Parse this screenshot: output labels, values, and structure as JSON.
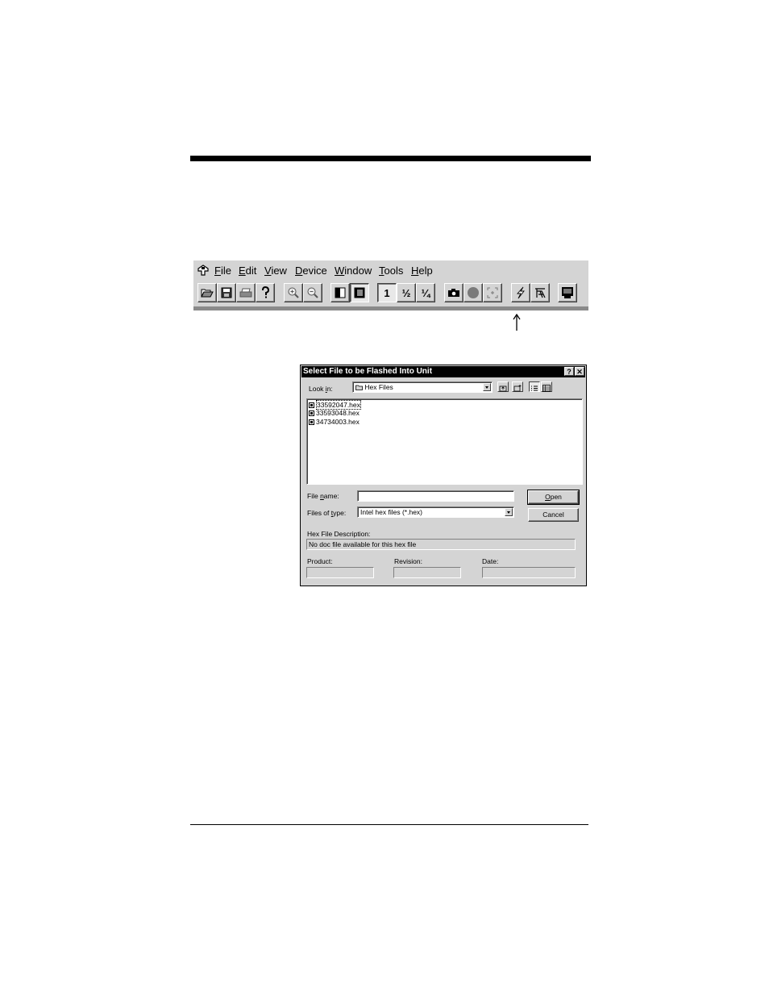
{
  "menubar": {
    "items": [
      {
        "pre": "",
        "u": "F",
        "post": "ile"
      },
      {
        "pre": "",
        "u": "E",
        "post": "dit"
      },
      {
        "pre": "",
        "u": "V",
        "post": "iew"
      },
      {
        "pre": "",
        "u": "D",
        "post": "evice"
      },
      {
        "pre": "",
        "u": "W",
        "post": "indow"
      },
      {
        "pre": "",
        "u": "T",
        "post": "ools"
      },
      {
        "pre": "",
        "u": "H",
        "post": "elp"
      }
    ]
  },
  "toolbar": {
    "zoom_1": "1",
    "zoom_half": "½",
    "zoom_quarter": "¼",
    "icons": [
      "open-folder-icon",
      "save-icon",
      "print-icon",
      "help-icon",
      "zoom-in-icon",
      "zoom-out-icon",
      "invert-icon",
      "contrast-icon",
      "zoom-1-icon",
      "zoom-half-icon",
      "zoom-quarter-icon",
      "camera-icon",
      "record-icon",
      "target-icon",
      "flash-icon",
      "signal-icon",
      "monitor-icon"
    ]
  },
  "dialog": {
    "title": "Select File to be Flashed Into Unit",
    "help_btn": "?",
    "close_btn": "✕",
    "look_in_label_pre": "Look ",
    "look_in_label_u": "i",
    "look_in_label_post": "n:",
    "look_in_value": "Hex Files",
    "files": [
      "33592047.hex",
      "33593048.hex",
      "34734003.hex"
    ],
    "file_name_label_pre": "File ",
    "file_name_label_u": "n",
    "file_name_label_post": "ame:",
    "file_name_value": "",
    "files_of_type_label_pre": "Files of ",
    "files_of_type_label_u": "t",
    "files_of_type_label_post": "ype:",
    "files_of_type_value": "Intel hex files (*.hex)",
    "open_pre": "",
    "open_u": "O",
    "open_post": "pen",
    "cancel": "Cancel",
    "hex_desc_label": "Hex File Description:",
    "hex_desc_value": "No doc file available for this hex file",
    "product_label": "Product:",
    "revision_label": "Revision:",
    "date_label": "Date:"
  },
  "colors": {
    "dialog_bg": "#d4d4d4",
    "titlebar": "#000000"
  }
}
